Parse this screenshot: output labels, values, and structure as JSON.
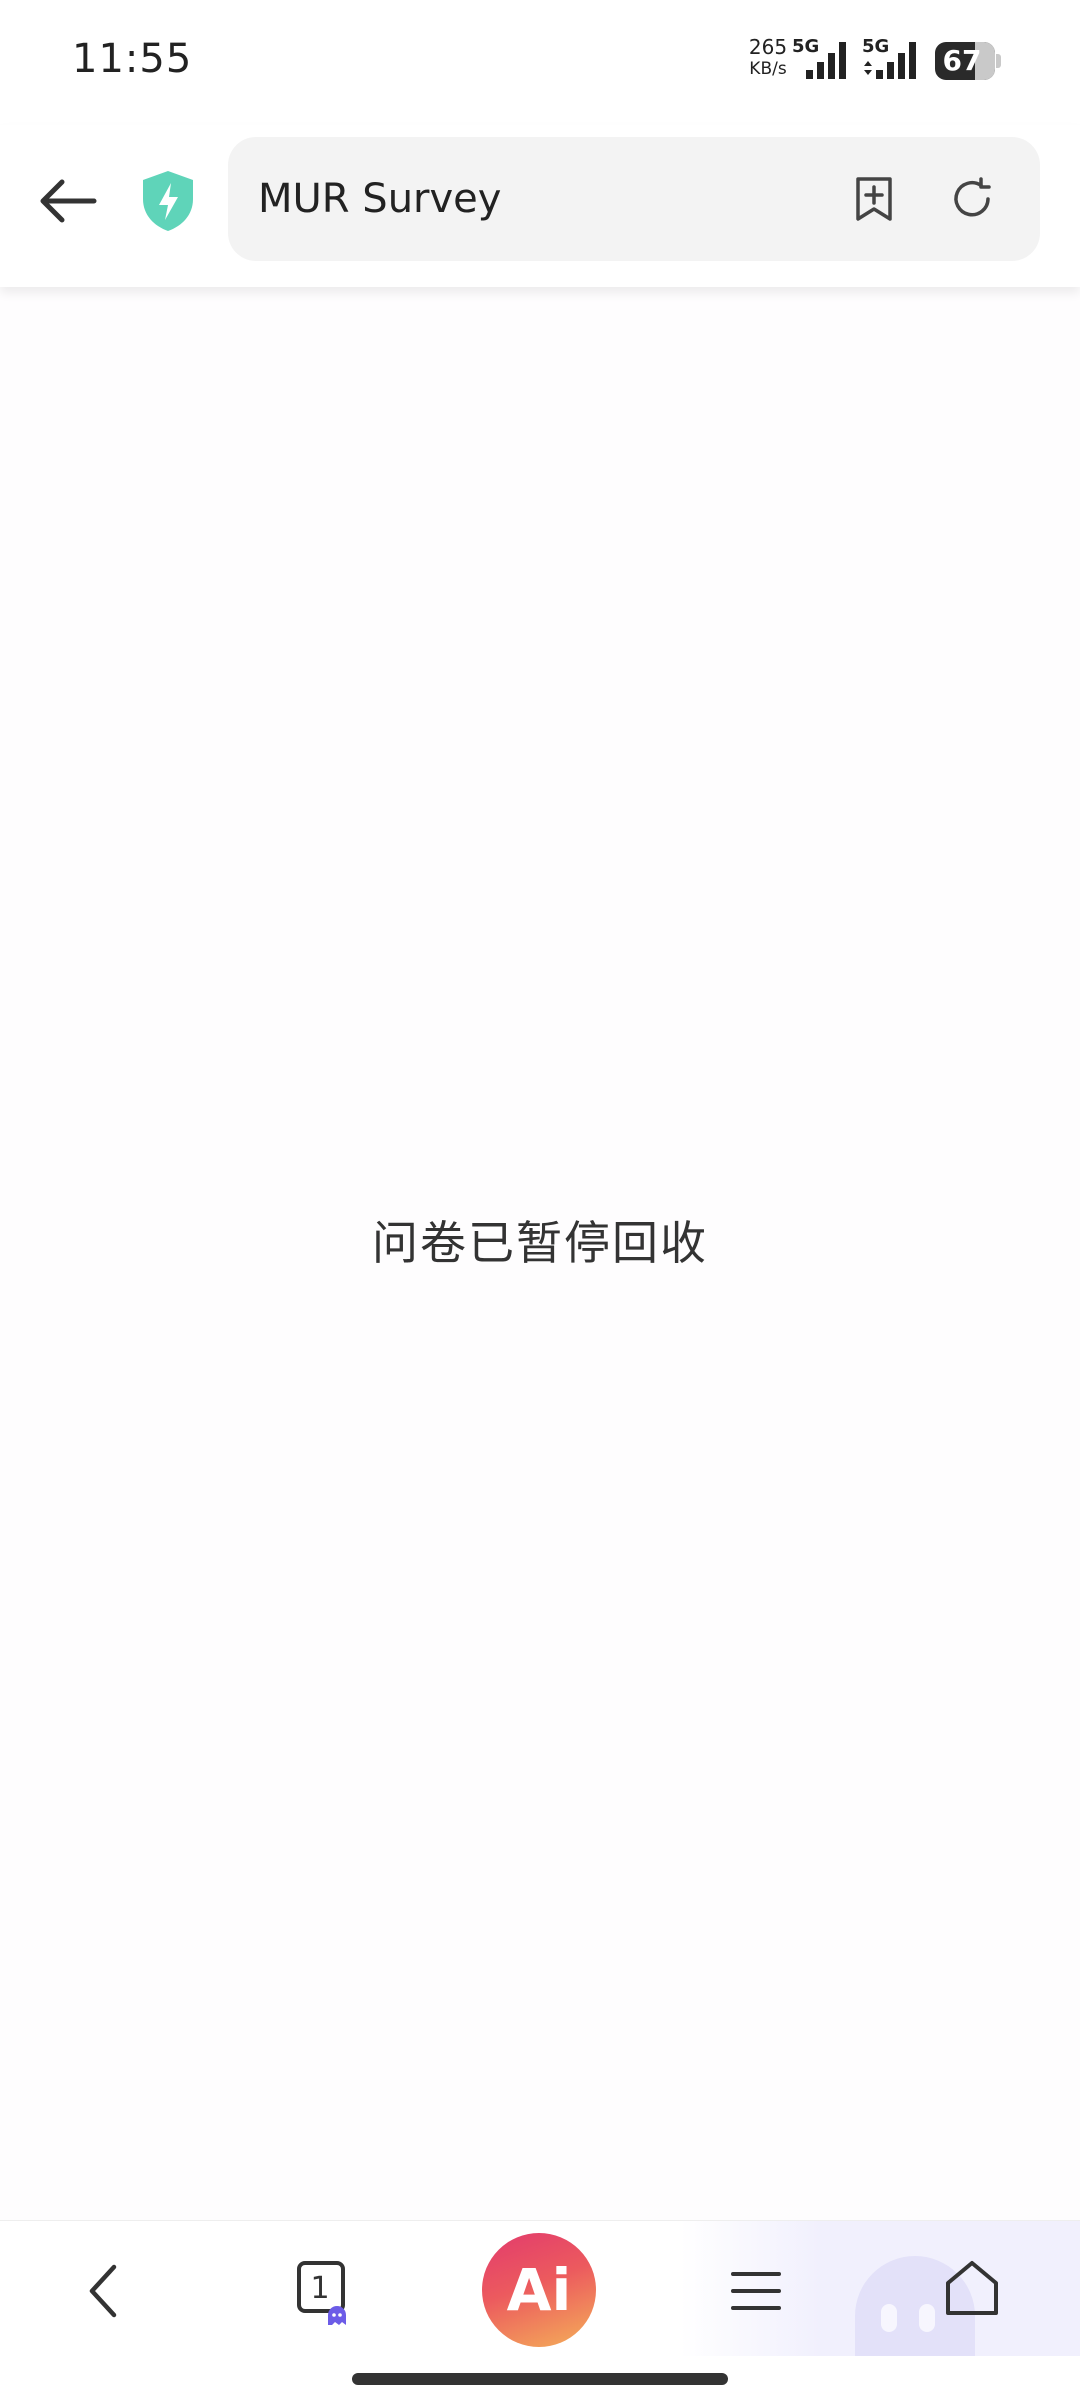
{
  "status_bar": {
    "time": "11:55",
    "net_speed_value": "265",
    "net_speed_unit": "KB/s",
    "signal_1_label": "5G",
    "signal_2_label": "5G",
    "battery_percent": "67"
  },
  "nav": {
    "url_title": "MUR Survey"
  },
  "content": {
    "message": "问卷已暂停回收"
  },
  "toolbar": {
    "tab_count": "1",
    "ai_label": "Ai"
  },
  "colors": {
    "shield": "#5fd4b9",
    "ai_gradient_start": "#e23b6d",
    "ai_gradient_end": "#f5b05a",
    "tab_badge": "#6c5ce7"
  }
}
